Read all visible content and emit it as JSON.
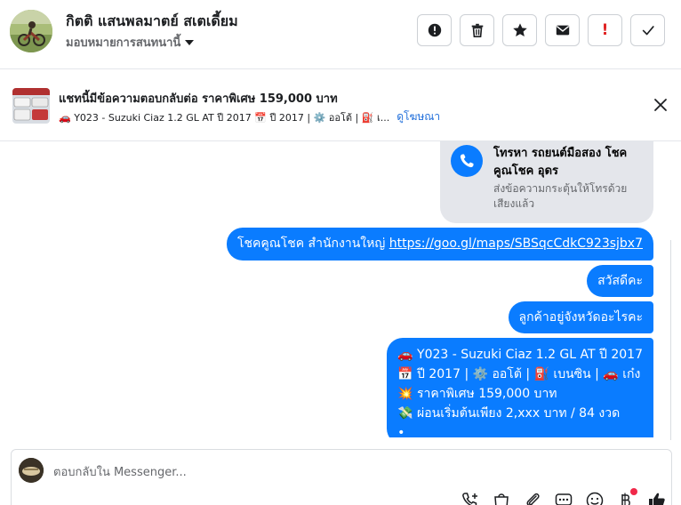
{
  "header": {
    "contact_name": "กิตติ แสนพลมาตย์ สเตเดี้ยม",
    "assign_label": "มอบหมายการสนทนานี้",
    "action_icons": [
      "alert-circle-icon",
      "trash-icon",
      "star-icon",
      "mail-icon",
      "exclamation-icon",
      "check-icon"
    ],
    "exclamation_label": "!"
  },
  "banner": {
    "title": "แชทนี้มีข้อความตอบกลับต่อ ราคาพิเศษ 159,000 บาท",
    "subtitle": "🚗 Y023 - Suzuki Ciaz 1.2 GL AT ปี 2017 📅 ปี 2017 | ⚙️ ออโต้ | ⛽ เ...",
    "link_label": "ดูโฆษณา"
  },
  "call_card": {
    "title": "โทรหา รถยนต์มือสอง โชคคูณโชค อุดร",
    "subtitle": "ส่งข้อความกระตุ้นให้โทรด้วยเสียงแล้ว"
  },
  "messages": {
    "m1_text": "โชคคูณโชค สำนักงานใหญ่ ",
    "m1_url": "https://goo.gl/maps/SBSqcCdkC923sjbx7",
    "m2": "สวัสดีคะ",
    "m3": "ลูกค้าอยู่จังหวัดอะไรคะ",
    "m4_lines": [
      "🚗 Y023 - Suzuki Ciaz 1.2 GL AT ปี 2017",
      "📅 ปี 2017 | ⚙️ ออโต้ | ⛽ เบนซิน | 🚗 เก๋ง",
      "💥 ราคาพิเศษ 159,000 บาท",
      "💸 ผ่อนเริ่มต้นเพียง 2,xxx บาท / 84 งวด",
      "•"
    ]
  },
  "composer": {
    "placeholder": "ตอบกลับใน Messenger...",
    "tool_icons": [
      "phone-plus-icon",
      "bag-icon",
      "paperclip-icon",
      "chat-bubble-icon",
      "emoji-icon",
      "currency-icon",
      "thumbs-up-icon"
    ]
  },
  "colors": {
    "accent": "#0a7cff",
    "link": "#216fdb",
    "badge": "#f02849",
    "exclamation": "#e02424"
  }
}
